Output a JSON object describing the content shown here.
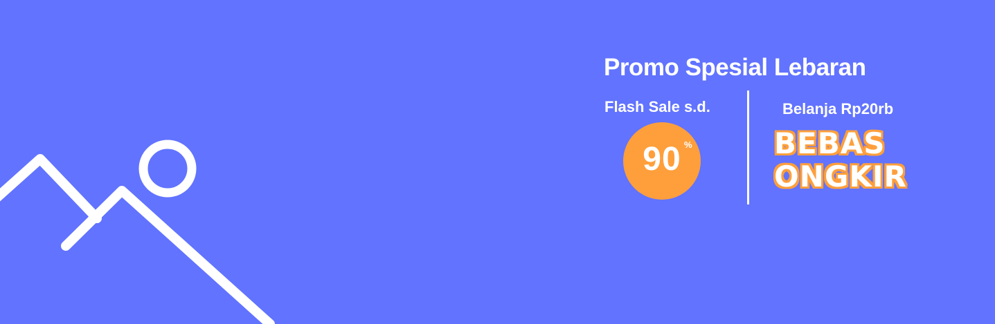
{
  "promo": {
    "title": "Promo Spesial Lebaran",
    "flash_sale_label": "Flash Sale s.d.",
    "discount_value": "90",
    "discount_unit": "%",
    "shipping_label": "Belanja Rp20rb",
    "free_shipping_line1": "BEBAS",
    "free_shipping_line2": "ONGKIR"
  },
  "colors": {
    "background": "#6173ff",
    "accent": "#ff9f3b",
    "text": "#ffffff"
  },
  "icons": {
    "placeholder": "image-placeholder-icon"
  }
}
